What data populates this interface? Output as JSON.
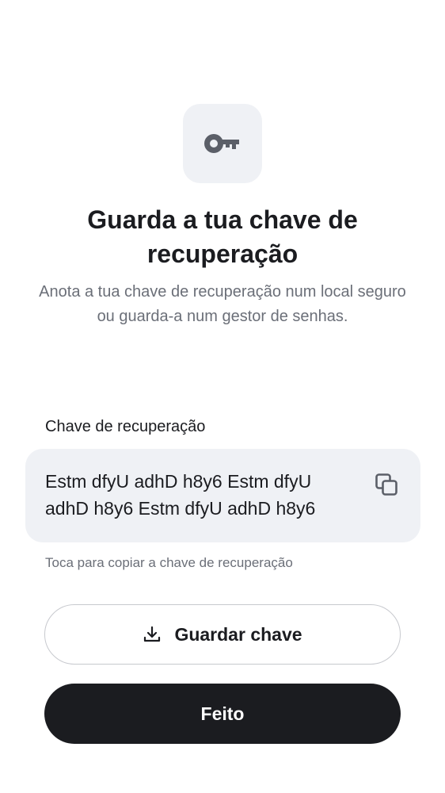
{
  "header": {
    "icon": "key-icon",
    "title": "Guarda a tua chave de recuperação",
    "subtitle": "Anota a tua chave de recuperação num local seguro ou guarda-a num gestor de senhas."
  },
  "recovery_key": {
    "label": "Chave de recuperação",
    "value": "Estm dfyU adhD h8y6 Estm dfyU adhD h8y6 Estm dfyU adhD h8y6",
    "copy_icon": "copy-icon",
    "hint": "Toca para copiar a chave de recuperação"
  },
  "actions": {
    "save_label": "Guardar chave",
    "save_icon": "download-icon",
    "done_label": "Feito"
  },
  "colors": {
    "background": "#ffffff",
    "surface": "#eff1f5",
    "primary": "#1b1c20",
    "secondary_text": "#6b6f78",
    "icon": "#5b5f68"
  }
}
